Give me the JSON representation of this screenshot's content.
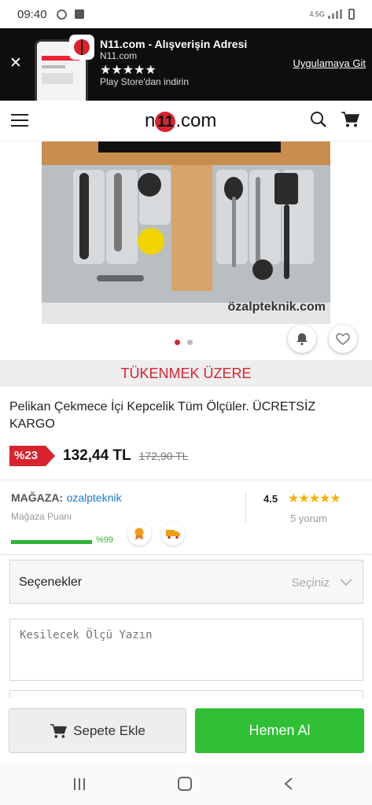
{
  "status_bar": {
    "time": "09:40",
    "network": "4.5G"
  },
  "app_banner": {
    "title": "N11.com - Alışverişin Adresi",
    "subtitle": "N11.com",
    "stars": "★★★★★",
    "store_text": "Play Store'dan indirin",
    "cta": "Uygulamaya Git"
  },
  "header": {
    "brand_prefix": "n",
    "brand_one": "11",
    "brand_suffix": ".com"
  },
  "gallery": {
    "watermark": "özalpteknik.com",
    "active_slide": 1,
    "slide_count": 2
  },
  "product": {
    "stock_status": "TÜKENMEK ÜZERE",
    "title": "Pelikan Çekmece İçi Kepcelik Tüm Ölçüler. ÜCRETSİZ KARGO",
    "discount": "%23",
    "price": "132,44 TL",
    "old_price": "172,90 TL"
  },
  "store": {
    "label": "MAĞAZA:",
    "name": "ozalpteknik",
    "score_label": "Mağaza Puanı",
    "score": "%99",
    "score_value": 0.99,
    "rating": "4.5",
    "rating_stars": "★★★★★",
    "reviews": "5 yorum"
  },
  "options": {
    "label": "Seçenekler",
    "select_placeholder": "Seçiniz"
  },
  "custom_input": {
    "placeholder": "Kesilecek Ölçü Yazın"
  },
  "actions": {
    "add_to_cart": "Sepete Ekle",
    "buy_now": "Hemen Al"
  },
  "colors": {
    "brand_red": "#d9232e",
    "buy_green": "#2fbf34",
    "link_blue": "#1a7bd1",
    "star_gold": "#f5b301"
  }
}
